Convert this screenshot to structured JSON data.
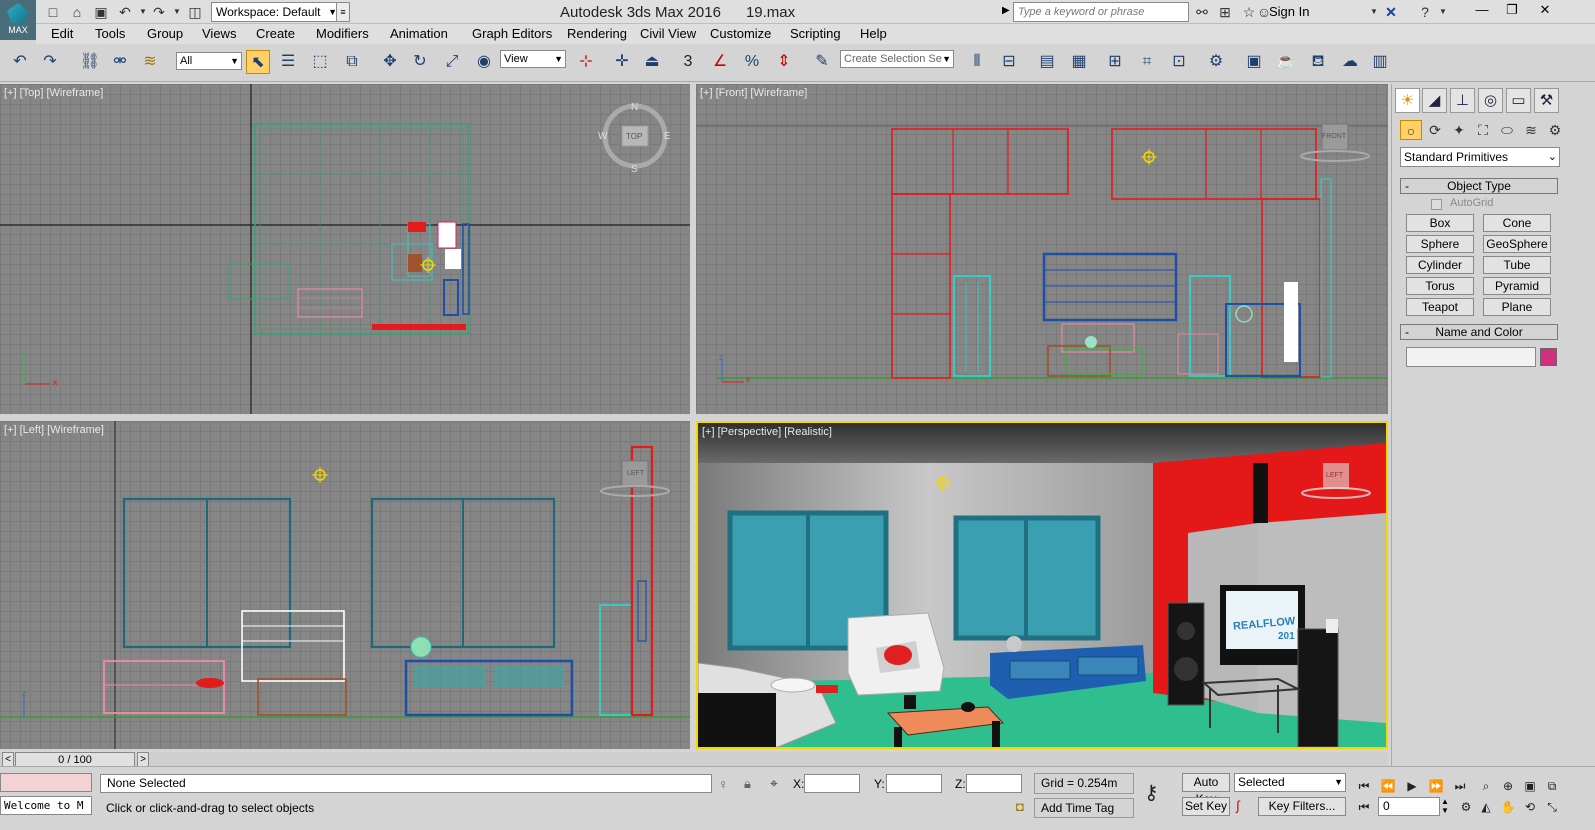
{
  "app": {
    "logo_label": "MAX",
    "title": "Autodesk 3ds Max 2016      19.max"
  },
  "workspace": {
    "value": "Workspace: Default"
  },
  "search": {
    "placeholder": "Type a keyword or phrase"
  },
  "account": {
    "sign_in": "Sign In"
  },
  "menus": [
    "Edit",
    "Tools",
    "Group",
    "Views",
    "Create",
    "Modifiers",
    "Animation",
    "Graph Editors",
    "Rendering",
    "Civil View",
    "Customize",
    "Scripting",
    "Help"
  ],
  "toolbar": {
    "selection_filter": "All",
    "ref_coord": "View",
    "snap_label": "3",
    "selection_set_placeholder": "Create Selection Se"
  },
  "viewports": {
    "top": {
      "label": "[+] [Top] [Wireframe]",
      "cube": "TOP",
      "compass": {
        "n": "N",
        "s": "S",
        "e": "E",
        "w": "W"
      }
    },
    "front": {
      "label": "[+] [Front] [Wireframe]",
      "cube": "FRONT"
    },
    "left": {
      "label": "[+] [Left] [Wireframe]",
      "cube": "LEFT"
    },
    "perspective": {
      "label": "[+] [Perspective] [Realistic]",
      "cube": "LEFT",
      "tv_text": "REALFLOW",
      "tv_year": "201"
    }
  },
  "axes": {
    "x": "x",
    "y": "y",
    "z": "z"
  },
  "command_panel": {
    "category": "Standard Primitives",
    "object_type_title": "Object Type",
    "autogrid": "AutoGrid",
    "buttons": [
      "Box",
      "Cone",
      "Sphere",
      "GeoSphere",
      "Cylinder",
      "Tube",
      "Torus",
      "Pyramid",
      "Teapot",
      "Plane"
    ],
    "name_color_title": "Name and Color",
    "color": "#d2307e"
  },
  "timeline": {
    "frame": "0 / 100",
    "prev": "<",
    "next": ">"
  },
  "status": {
    "selection": "None Selected",
    "prompt": "Click or click-and-drag to select objects",
    "maxscript": "Welcome to M",
    "x_label": "X:",
    "y_label": "Y:",
    "z_label": "Z:",
    "grid": "Grid = 0.254m",
    "add_time_tag": "Add Time Tag",
    "auto_key": "Auto Key",
    "set_key": "Set Key",
    "key_mode": "Selected",
    "key_filters": "Key Filters...",
    "current_frame": "0"
  },
  "colors": {
    "accent_yellow": "#f5d800",
    "viewport_bg": "#868686",
    "wire_red": "#e31b1b",
    "wire_teal": "#3cc7c0",
    "wire_blue": "#1b4fa8"
  }
}
